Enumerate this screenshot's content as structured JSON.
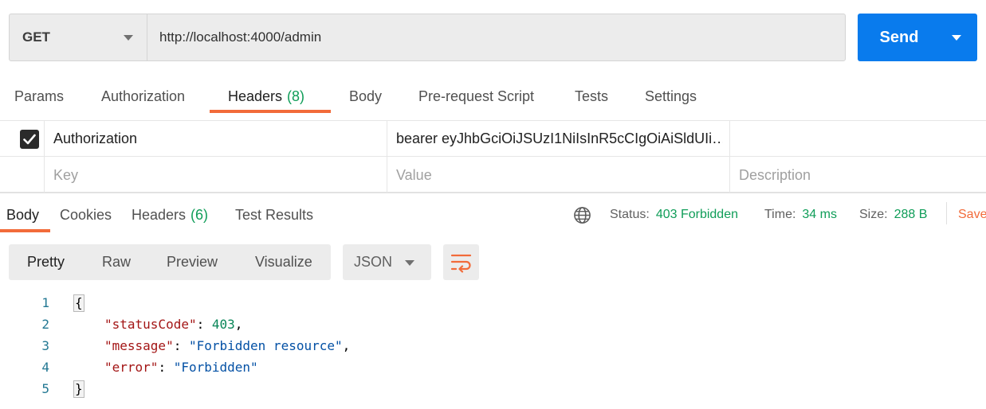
{
  "request": {
    "method": "GET",
    "url": "http://localhost:4000/admin",
    "send_label": "Send"
  },
  "request_tabs": [
    {
      "label": "Params"
    },
    {
      "label": "Authorization"
    },
    {
      "label": "Headers",
      "count": "(8)"
    },
    {
      "label": "Body"
    },
    {
      "label": "Pre-request Script"
    },
    {
      "label": "Tests"
    },
    {
      "label": "Settings"
    }
  ],
  "headers_table": {
    "row": {
      "checked": true,
      "key": "Authorization",
      "value": "bearer eyJhbGciOiJSUzI1NiIsInR5cCIgOiAiSldUIi…"
    },
    "placeholders": {
      "key": "Key",
      "value": "Value",
      "description": "Description"
    }
  },
  "response_tabs": [
    {
      "label": "Body"
    },
    {
      "label": "Cookies"
    },
    {
      "label": "Headers",
      "count": "(6)"
    },
    {
      "label": "Test Results"
    }
  ],
  "response_status": {
    "status_label": "Status:",
    "status_value": "403 Forbidden",
    "time_label": "Time:",
    "time_value": "34 ms",
    "size_label": "Size:",
    "size_value": "288 B",
    "save_label": "Save"
  },
  "view_modes": [
    "Pretty",
    "Raw",
    "Preview",
    "Visualize"
  ],
  "format": "JSON",
  "code_lines": [
    {
      "n": "1",
      "text": "{"
    },
    {
      "n": "2",
      "key": "\"statusCode\"",
      "value": "403",
      "trail": ","
    },
    {
      "n": "3",
      "key": "\"message\"",
      "value": "\"Forbidden resource\"",
      "trail": ","
    },
    {
      "n": "4",
      "key": "\"error\"",
      "value": "\"Forbidden\"",
      "trail": ""
    },
    {
      "n": "5",
      "text": "}"
    }
  ],
  "colors": {
    "accent": "#f26b3a",
    "send": "#097bed",
    "success": "#0f9d58"
  }
}
